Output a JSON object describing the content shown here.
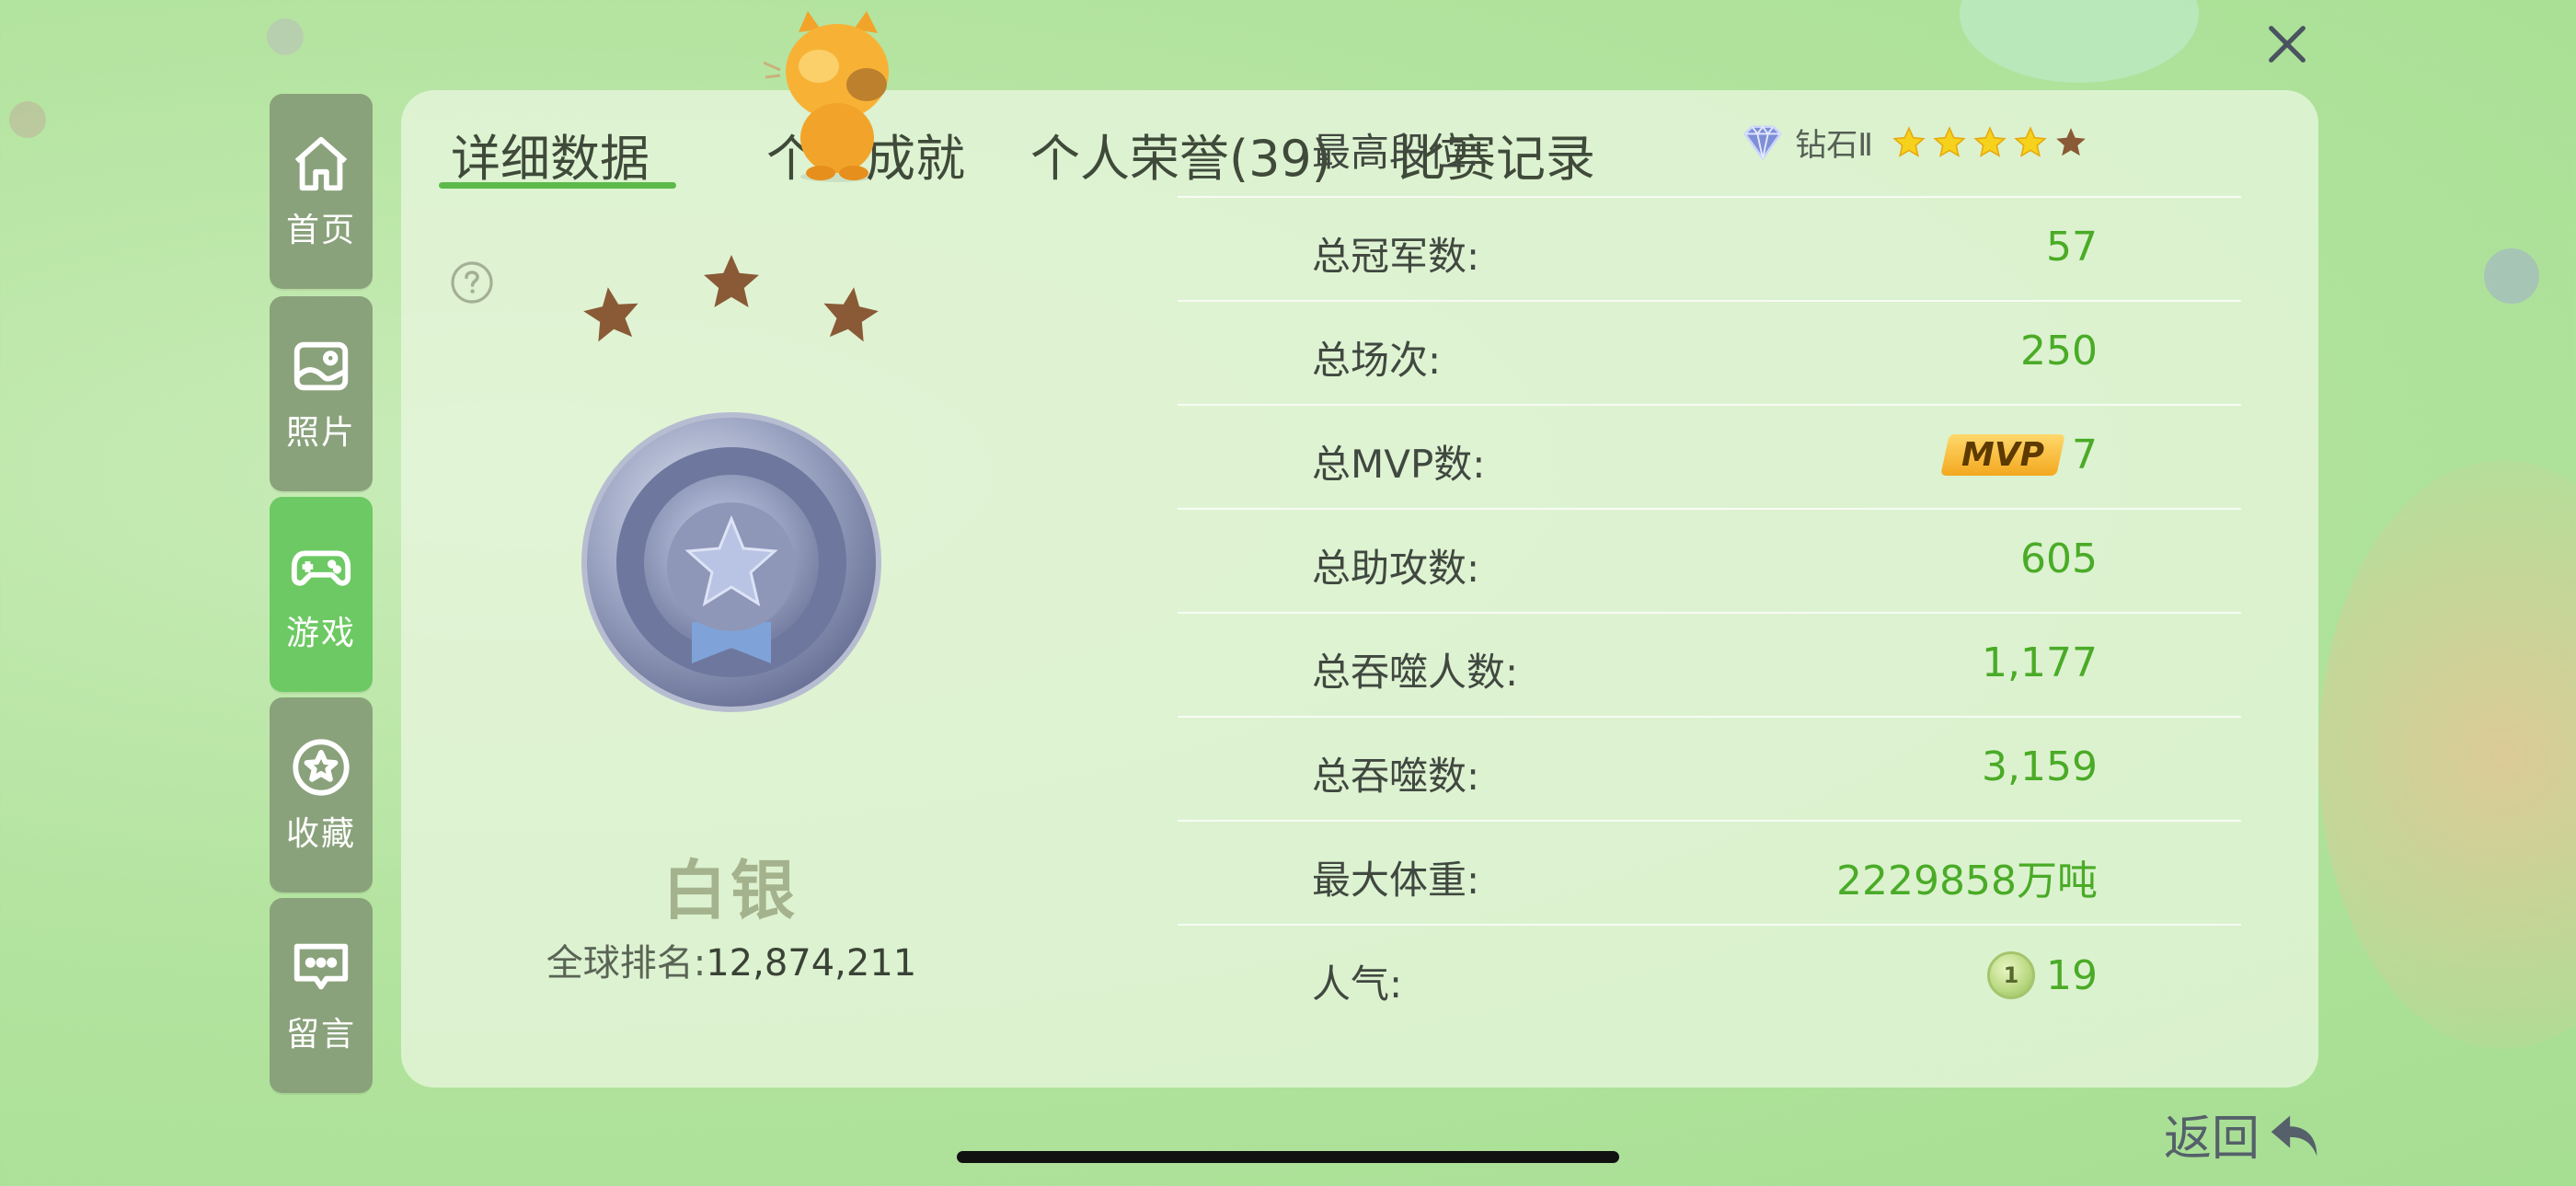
{
  "nav": {
    "items": [
      {
        "label": "首页",
        "icon": "home-icon",
        "active": false
      },
      {
        "label": "照片",
        "icon": "photo-icon",
        "active": false
      },
      {
        "label": "游戏",
        "icon": "gamepad-icon",
        "active": true
      },
      {
        "label": "收藏",
        "icon": "star-bookmark-icon",
        "active": false
      },
      {
        "label": "留言",
        "icon": "message-icon",
        "active": false
      }
    ]
  },
  "tabs": [
    {
      "label": "详细数据",
      "active": true
    },
    {
      "label": "个人成就",
      "active": false
    },
    {
      "label": "个人荣誉(39)",
      "active": false
    },
    {
      "label": "比赛记录",
      "active": false
    }
  ],
  "rank": {
    "name": "白银",
    "global_rank_label": "全球排名:",
    "global_rank_value": "12,874,211",
    "stars_filled": 0,
    "stars_total": 3
  },
  "stats": [
    {
      "label": "最高段位:",
      "value": "钻石Ⅱ",
      "stars_filled": 4,
      "stars_total": 5
    },
    {
      "label": "总冠军数:",
      "value": "57"
    },
    {
      "label": "总场次:",
      "value": "250"
    },
    {
      "label": "总MVP数:",
      "value": "7",
      "badge": "MVP"
    },
    {
      "label": "总助攻数:",
      "value": "605"
    },
    {
      "label": "总吞噬人数:",
      "value": "1,177"
    },
    {
      "label": "总吞噬数:",
      "value": "3,159"
    },
    {
      "label": "最大体重:",
      "value": "2229858万吨"
    },
    {
      "label": "人气:",
      "value": "19",
      "coin": "1"
    }
  ],
  "back": {
    "label": "返回"
  },
  "colors": {
    "accent_green": "#4aab27",
    "nav_active": "#6dc963",
    "nav_inactive": "#8aa27b",
    "star_filled": "#f7d21c",
    "star_empty": "#8a5a36"
  }
}
